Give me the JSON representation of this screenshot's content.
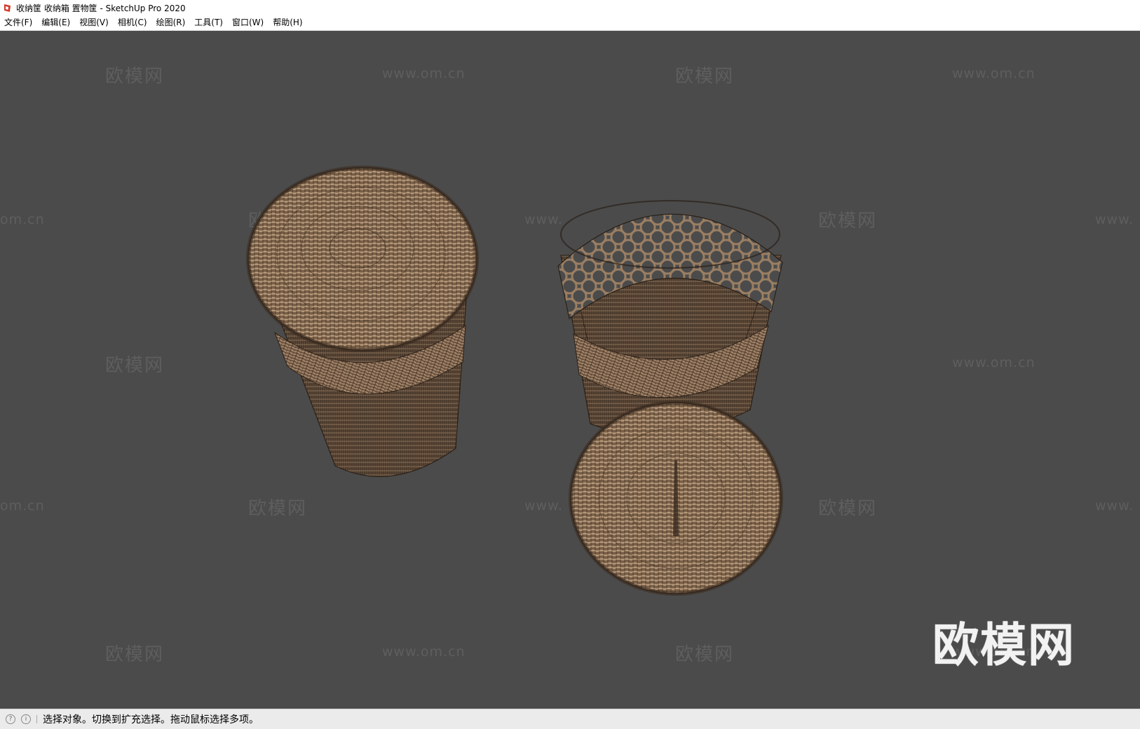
{
  "window": {
    "title": "收纳筐 收纳箱 置物筐 - SketchUp Pro 2020"
  },
  "menu": [
    "文件(F)",
    "编辑(E)",
    "视图(V)",
    "相机(C)",
    "绘图(R)",
    "工具(T)",
    "窗口(W)",
    "帮助(H)"
  ],
  "watermarks": {
    "cn": "欧模网",
    "url": "www.om.cn",
    "url_partial_left": "om.cn",
    "url_partial_right": "www.",
    "url_partial_mid": "www.",
    "big_logo": "欧模网"
  },
  "status": {
    "message": "选择对象。切换到扩充选择。拖动鼠标选择多项。"
  },
  "colors": {
    "viewport": "#4b4b4b",
    "wicker": "#7a6048",
    "wicker_light": "#a88c70",
    "wire": "#2a2018"
  }
}
